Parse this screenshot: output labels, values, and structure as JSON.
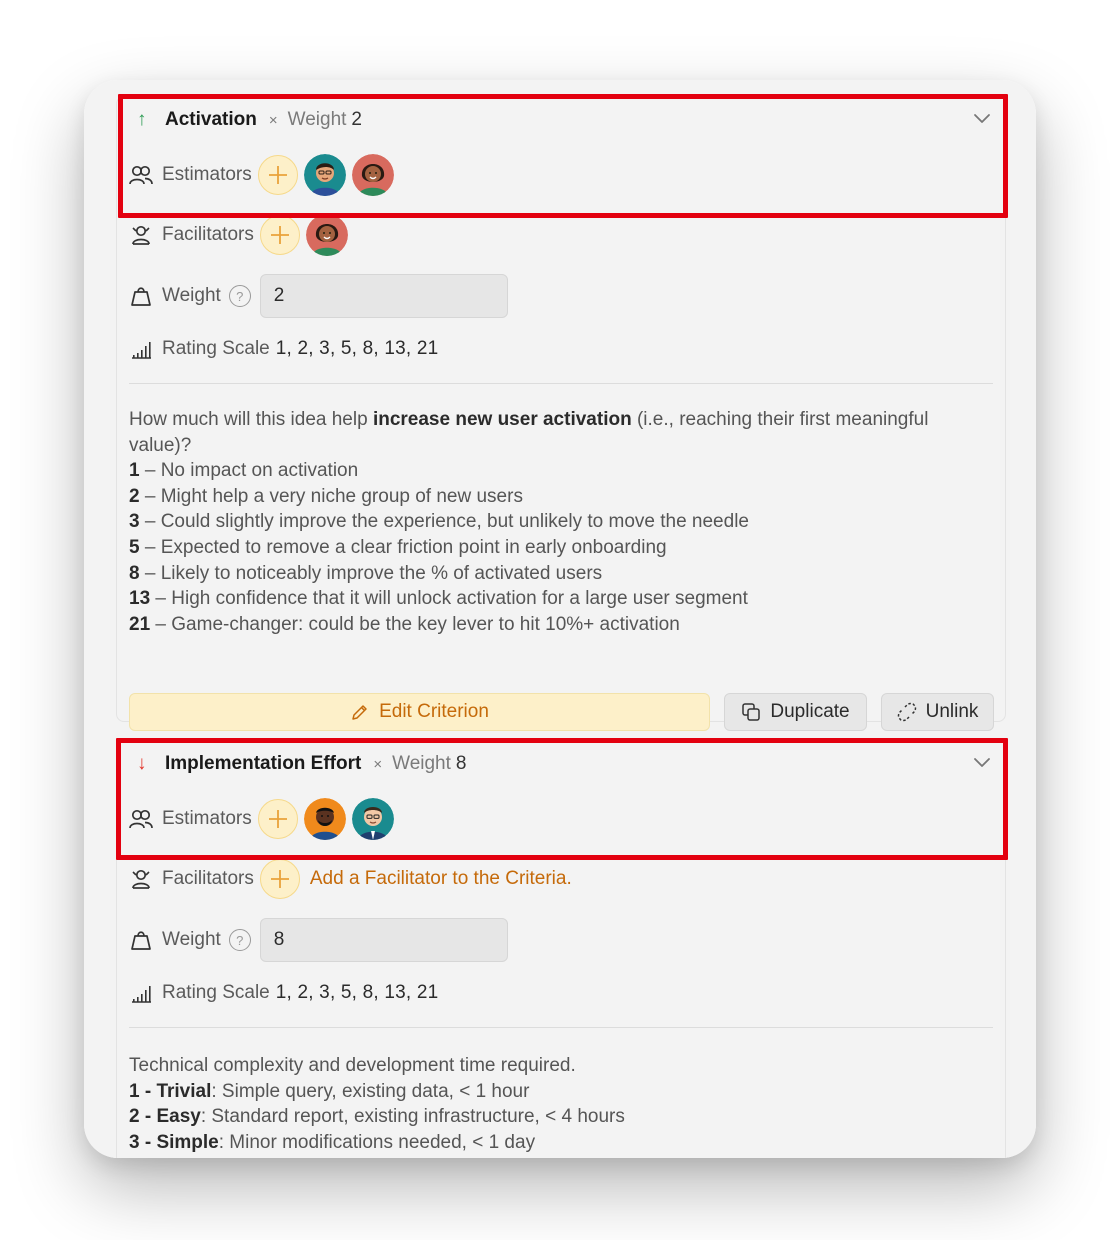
{
  "criteria": [
    {
      "direction": "up",
      "name": "Activation",
      "times": "×",
      "weight_label": "Weight",
      "weight_value": "2",
      "estimators_label": "Estimators",
      "facilitators_label": "Facilitators",
      "weight_field_label": "Weight",
      "weight_input": "2",
      "rating_scale_label": "Rating Scale",
      "rating_scale": "1, 2, 3, 5, 8, 13, 21",
      "description_intro_pre": "How much will this idea help ",
      "description_intro_bold": "increase new user activation",
      "description_intro_post": " (i.e., reaching their first meaningful value)?",
      "levels": [
        {
          "score": "1",
          "text": " – No impact on activation"
        },
        {
          "score": "2",
          "text": " – Might help a very niche group of new users"
        },
        {
          "score": "3",
          "text": " – Could slightly improve the experience, but unlikely to move the needle"
        },
        {
          "score": "5",
          "text": " – Expected to remove a clear friction point in early onboarding"
        },
        {
          "score": "8",
          "text": " – Likely to noticeably improve the % of activated users"
        },
        {
          "score": "13",
          "text": " – High confidence that it will unlock activation for a large user segment"
        },
        {
          "score": "21",
          "text": " – Game-changer: could be the key lever to hit 10%+ activation"
        }
      ],
      "buttons": {
        "edit": "Edit Criterion",
        "duplicate": "Duplicate",
        "unlink": "Unlink"
      }
    },
    {
      "direction": "down",
      "name": "Implementation Effort",
      "times": "×",
      "weight_label": "Weight",
      "weight_value": "8",
      "estimators_label": "Estimators",
      "facilitators_label": "Facilitators",
      "facilitator_hint": "Add a Facilitator to the Criteria.",
      "weight_field_label": "Weight",
      "weight_input": "8",
      "rating_scale_label": "Rating Scale",
      "rating_scale": "1, 2, 3, 5, 8, 13, 21",
      "description_intro": "Technical complexity and development time required.",
      "levels": [
        {
          "score": "1 - Trivial",
          "text": ": Simple query, existing data, < 1 hour"
        },
        {
          "score": "2 - Easy",
          "text": ": Standard report, existing infrastructure, < 4 hours"
        },
        {
          "score": "3 - Simple",
          "text": ": Minor modifications needed, < 1 day"
        }
      ]
    }
  ],
  "colors": {
    "up_arrow": "#2e9c55",
    "down_arrow": "#e2352a",
    "accent": "#c56a0a",
    "highlight": "#e3000f",
    "add_button_bg": "#fdf0c9"
  },
  "icons": [
    "arrow-up-icon",
    "arrow-down-icon",
    "chevron-down-icon",
    "estimators-icon",
    "facilitators-icon",
    "plus-icon",
    "weight-icon",
    "help-icon",
    "rating-scale-icon",
    "pencil-icon",
    "duplicate-icon",
    "unlink-icon"
  ]
}
